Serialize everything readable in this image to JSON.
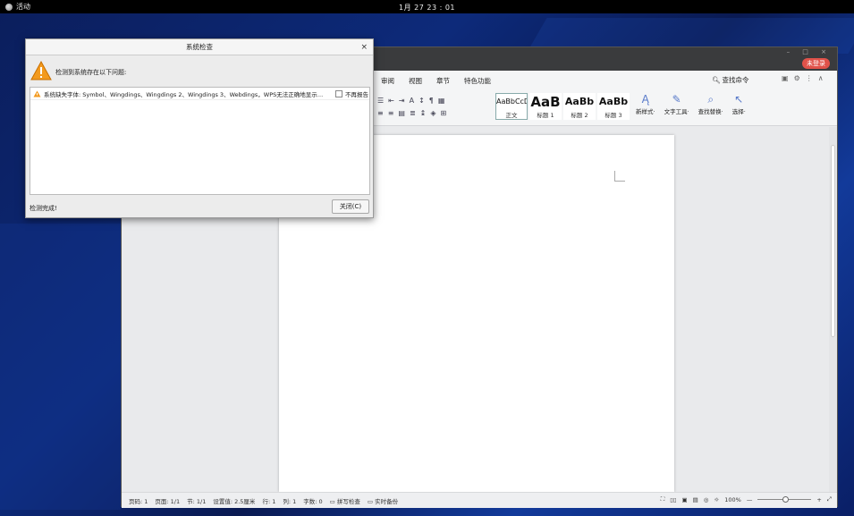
{
  "topbar": {
    "activities": "活动",
    "clock": "1月 27  23 : 01"
  },
  "wps": {
    "login_badge": "未登录",
    "menu": [
      "审阅",
      "视图",
      "章节",
      "特色功能"
    ],
    "search_cmd": "查找命令",
    "styles": [
      {
        "preview": "AaBbCcD",
        "name": "正文"
      },
      {
        "preview": "AaB",
        "name": "标题 1"
      },
      {
        "preview": "AaBb",
        "name": "标题 2"
      },
      {
        "preview": "AaBb",
        "name": "标题 3"
      }
    ],
    "tools": [
      {
        "label": "新样式·",
        "icon": "new-style-icon"
      },
      {
        "label": "文字工具·",
        "icon": "text-tools-icon"
      },
      {
        "label": "查找替换·",
        "icon": "find-replace-icon"
      },
      {
        "label": "选择·",
        "icon": "select-icon"
      }
    ],
    "status": {
      "page": "页码: 1",
      "pages": "页面: 1/1",
      "section": "节: 1/1",
      "setting": "设置值: 2.5厘米",
      "line": "行: 1",
      "col": "列: 1",
      "words": "字数: 0",
      "spell": "拼写检查",
      "backup": "实时备份",
      "zoom": "100%"
    }
  },
  "dialog": {
    "title": "系统检查",
    "close_glyph": "×",
    "message": "检测到系统存在以下问题:",
    "issues": [
      {
        "text": "系统缺失字体: Symbol、Wingdings、Wingdings 2、Wingdings 3、Webdings，WPS无法正确地显示…",
        "checkbox_label": "不再报告"
      }
    ],
    "status": "检测完成!",
    "close_button": "关闭(C)"
  }
}
